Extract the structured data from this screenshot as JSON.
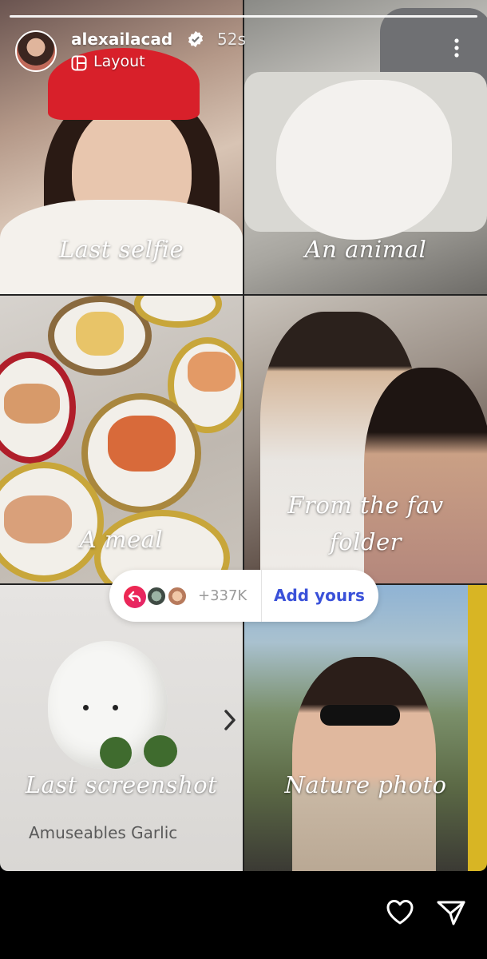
{
  "header": {
    "username": "alexailacad",
    "time": "52s",
    "layout_label": "Layout"
  },
  "prompts": {
    "cell1": "Last selfie",
    "cell2": "An animal",
    "cell3": "A meal",
    "cell4_line1": "From the fav",
    "cell4_line2": "folder",
    "cell5": "Last screenshot",
    "cell6": "Nature photo"
  },
  "add_yours": {
    "count": "+337K",
    "label": "Add yours"
  },
  "screenshot_product": "Amuseables Garlic",
  "icons": {
    "verified": "verified-badge-icon",
    "layout": "layout-icon",
    "more": "more-vertical-icon",
    "reply": "reply-arrow-icon",
    "chevron": "chevron-right-icon",
    "like": "heart-icon",
    "share": "send-icon"
  },
  "colors": {
    "accent_blue": "#3a51d9",
    "reply_pink": "#e3266c"
  }
}
